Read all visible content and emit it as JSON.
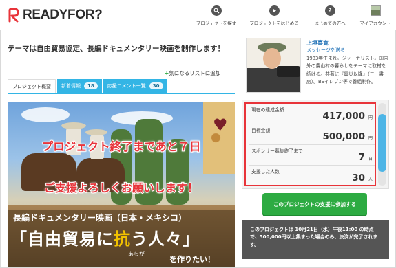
{
  "brand": {
    "logo_text": "READYFOR?",
    "accent_color": "#e8343a"
  },
  "nav": {
    "items": [
      {
        "label": "プロジェクトを探す",
        "icon": "search-icon"
      },
      {
        "label": "プロジェクトをはじめる",
        "icon": "play-icon"
      },
      {
        "label": "はじめての方へ",
        "icon": "help-icon"
      },
      {
        "label": "マイアカウント",
        "icon": "avatar-icon"
      }
    ]
  },
  "project": {
    "title": "テーマは自由貿易協定、長編ドキュメンタリー映画を制作します！",
    "favorite_label": "気になるリストに追加",
    "tabs": [
      {
        "label": "プロジェクト概要",
        "badge": ""
      },
      {
        "label": "新着情報",
        "badge": "18"
      },
      {
        "label": "応援コメント一覧",
        "badge": "30"
      }
    ]
  },
  "hero": {
    "line1": "プロジェクト終了まであと７日",
    "line2": "ご支援よろしくお願いします！",
    "line3": "長編ドキュメンタリー映画（日本・メキシコ）",
    "line4_pre": "「自由貿易に",
    "line4_accent": "抗",
    "line4_post": "う人々」",
    "ruby": "あらが",
    "line5": "を作りたい！"
  },
  "owner": {
    "name": "上垣喜寛",
    "message_link": "メッセージを送る",
    "bio": "1983年生まれ。ジャーナリスト。国内外の農山村の暮らしをテーマに取材を続ける。共著に『震災以降』（三一書房）。BSイレブン等で番組制作。"
  },
  "stats": [
    {
      "label": "現在の達成金額",
      "value": "417,000",
      "unit": "円"
    },
    {
      "label": "目標金額",
      "value": "500,000",
      "unit": "円"
    },
    {
      "label": "スポンサー募集終了まで",
      "value": "7",
      "unit": "日"
    },
    {
      "label": "支援した人数",
      "value": "30",
      "unit": "人"
    }
  ],
  "support_button": "このプロジェクトの支援に参加する",
  "notice": "このプロジェクトは 10月21日（水）午後11:00 の時点で、500,000円以上集まった場合のみ、決済が完了されます。"
}
